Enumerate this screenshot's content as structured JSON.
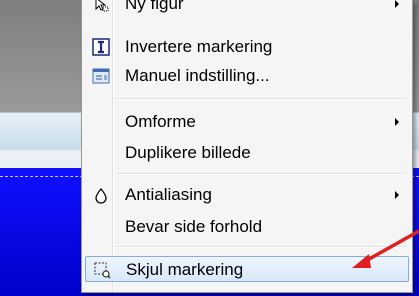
{
  "menu": {
    "items": [
      {
        "label": "Ny figur",
        "icon": "cursor-select-icon",
        "submenu": true
      },
      {
        "label": "Invertere markering",
        "icon": "text-cursor-icon",
        "submenu": false
      },
      {
        "label": "Manuel indstilling...",
        "icon": "settings-panel-icon",
        "submenu": false
      },
      {
        "label": "Omforme",
        "icon": "",
        "submenu": true
      },
      {
        "label": "Duplikere billede",
        "icon": "",
        "submenu": false
      },
      {
        "label": "Antialiasing",
        "icon": "droplet-icon",
        "submenu": true
      },
      {
        "label": "Bevar side forhold",
        "icon": "",
        "submenu": false
      },
      {
        "label": "Skjul markering",
        "icon": "hide-selection-icon",
        "submenu": false,
        "highlighted": true
      }
    ]
  },
  "annotation": {
    "arrow_color": "#e02020"
  },
  "colors": {
    "highlight_border": "#84acdd",
    "canvas_blue": "#0000ff"
  }
}
